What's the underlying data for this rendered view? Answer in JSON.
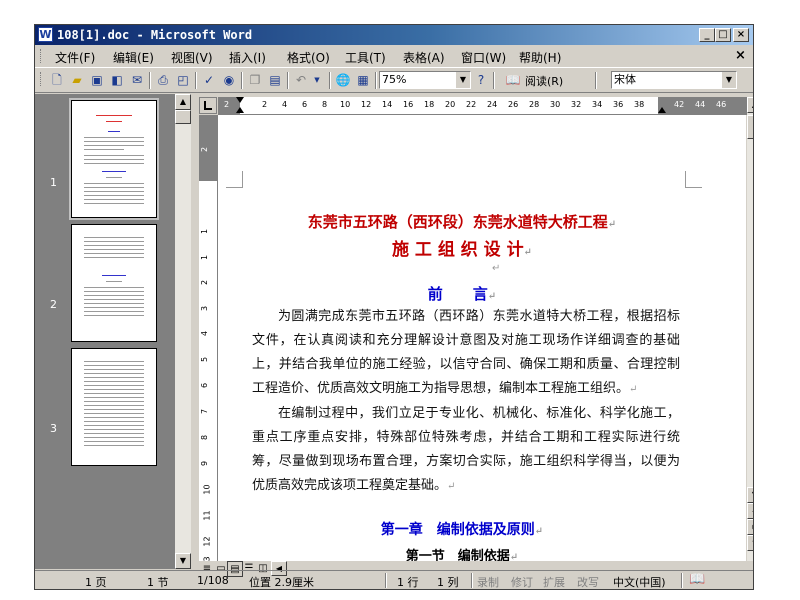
{
  "window": {
    "title": "108[1].doc - Microsoft Word",
    "controls": {
      "minimize": "_",
      "maximize": "□",
      "close": "×"
    }
  },
  "menu": {
    "items": [
      "文件(F)",
      "编辑(E)",
      "视图(V)",
      "插入(I)",
      "格式(O)",
      "工具(T)",
      "表格(A)",
      "窗口(W)",
      "帮助(H)"
    ],
    "close": "×"
  },
  "toolbar": {
    "zoom": "75%",
    "read_label": "阅读(R)",
    "font": "宋体",
    "icons": [
      "new-icon",
      "open-icon",
      "save-icon",
      "permission-icon",
      "email-icon",
      "print-icon",
      "print-preview-icon",
      "spelling-icon",
      "research-icon",
      "copy-icon",
      "paste-icon",
      "undo-icon",
      "hyperlink-icon",
      "table-icon",
      "help-icon",
      "read-icon"
    ]
  },
  "thumbnails": {
    "pages": [
      "1",
      "2",
      "3"
    ]
  },
  "ruler": {
    "h_ticks": [
      "2",
      "2",
      "4",
      "6",
      "8",
      "10",
      "12",
      "14",
      "16",
      "18",
      "20",
      "22",
      "24",
      "26",
      "28",
      "30",
      "32",
      "34",
      "36",
      "38",
      "42",
      "44",
      "46"
    ],
    "v_ticks": [
      "2",
      "1",
      "1",
      "2",
      "3",
      "4",
      "5",
      "6",
      "7",
      "8",
      "9",
      "10",
      "11",
      "12",
      "13"
    ]
  },
  "document": {
    "title1": "东莞市五环路（西环段）东莞水道特大桥工程",
    "title2": "施 工 组 织 设 计",
    "preface": "前　　言",
    "para1": "为圆满完成东莞市五环路（西环路）东莞水道特大桥工程，根据招标文件，在认真阅读和充分理解设计意图及对施工现场作详细调查的基础上，并结合我单位的施工经验，以信守合同、确保工期和质量、合理控制工程造价、优质高效文明施工为指导思想，编制本工程施工组织。",
    "para2": "在编制过程中，我们立足于专业化、机械化、标准化、科学化施工，重点工序重点安排，特殊部位特殊考虑，并结合工期和工程实际进行统筹，尽量做到现场布置合理，方案切合实际，施工组织科学得当，以便为优质高效完成该项工程奠定基础。",
    "chapter1": "第一章　编制依据及原则",
    "section1": "第一节　编制依据",
    "para_mark": "↵"
  },
  "status": {
    "page": "1 页",
    "section": "1 节",
    "page_of": "1/108",
    "position": "位置 2.9厘米",
    "line": "1 行",
    "column": "1 列",
    "rec": "录制",
    "trk": "修订",
    "ext": "扩展",
    "ovr": "改写",
    "language": "中文(中国)"
  }
}
